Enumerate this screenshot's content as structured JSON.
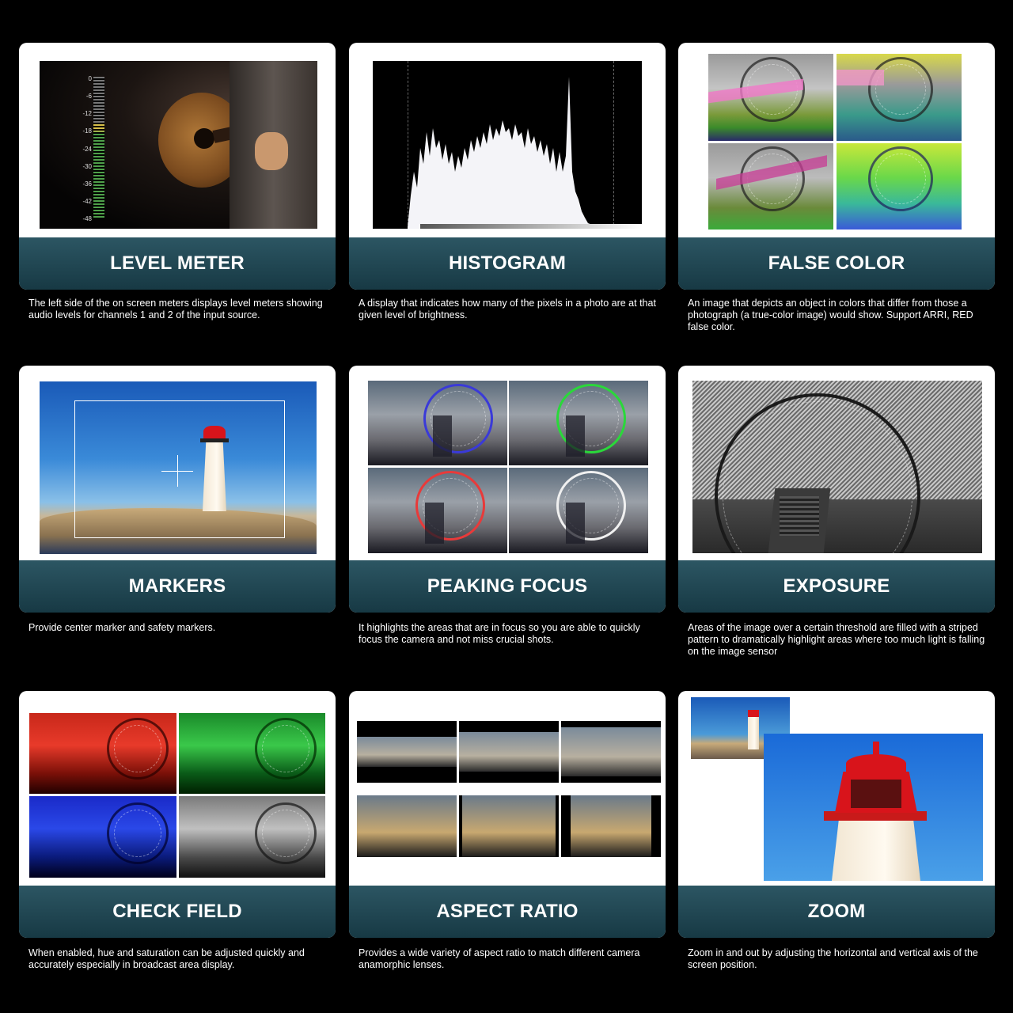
{
  "features": [
    {
      "title": "LEVEL METER",
      "description": "The left side of the on screen meters displays level meters showing audio levels for channels 1 and 2 of the input source."
    },
    {
      "title": "HISTOGRAM",
      "description": "A display that indicates how many of the pixels in a photo are at that given level of brightness."
    },
    {
      "title": "FALSE COLOR",
      "description": "An image that depicts an object in colors that differ from those a photograph (a true-color image) would show. Support ARRI, RED false color."
    },
    {
      "title": "MARKERS",
      "description": "Provide center marker and safety markers."
    },
    {
      "title": "PEAKING FOCUS",
      "description": "It highlights the areas that are in focus so you are able to quickly focus the camera and not miss crucial shots."
    },
    {
      "title": "EXPOSURE",
      "description": "Areas of the image over a certain threshold are filled with a striped pattern to dramatically highlight areas where too much light is falling on the image sensor"
    },
    {
      "title": "CHECK FIELD",
      "description": "When enabled, hue and saturation can be adjusted quickly and accurately especially in broadcast area display."
    },
    {
      "title": "ASPECT RATIO",
      "description": "Provides a wide variety of aspect ratio to match different camera anamorphic lenses."
    },
    {
      "title": "ZOOM",
      "description": "Zoom in and out by adjusting the horizontal and vertical axis of the screen position."
    }
  ],
  "level_meter_scale": [
    "0",
    "-6",
    "-12",
    "-18",
    "-24",
    "-30",
    "-36",
    "-42",
    "-48"
  ],
  "colors": {
    "background": "#000000",
    "band_top": "#2c5663",
    "band_bottom": "#173944",
    "card": "#ffffff"
  }
}
